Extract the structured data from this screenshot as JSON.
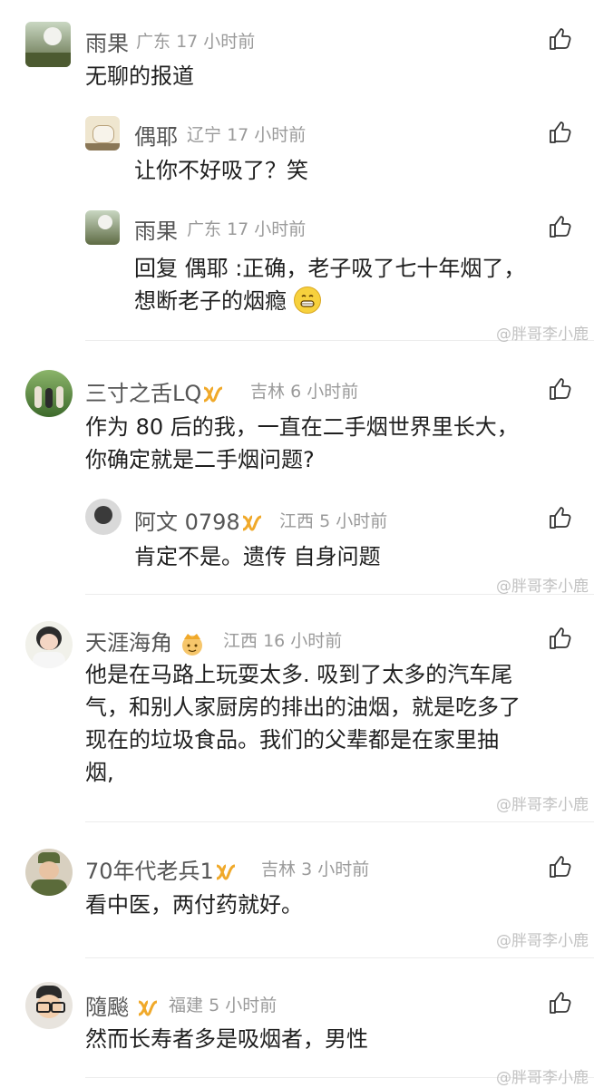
{
  "comments": [
    {
      "name": "雨果",
      "location": "广东",
      "time": "17 小时前",
      "text": "无聊的报道"
    },
    {
      "name": "偶耶",
      "location": "辽宁",
      "time": "17 小时前",
      "text": "让你不好吸了？笑"
    },
    {
      "name": "雨果",
      "location": "广东",
      "time": "17 小时前",
      "reply_prefix": "回复",
      "reply_target": "偶耶",
      "line1": ":正确，老子吸了七十年烟了，",
      "line2": "想断老子的烟瘾"
    },
    {
      "name": "三寸之舌LQ",
      "location": "吉林",
      "time": "6 小时前",
      "line1": "作为 80 后的我，一直在二手烟世界里长大，",
      "line2": "你确定就是二手烟问题?"
    },
    {
      "name": "阿文 0798",
      "location": "江西",
      "time": "5 小时前",
      "text": "肯定不是。遗传 自身问题"
    },
    {
      "name": "天涯海角",
      "location": "江西",
      "time": "16 小时前",
      "line1": "他是在马路上玩耍太多. 吸到了太多的汽车尾",
      "line2": "气，和别人家厨房的排出的油烟，就是吃多了",
      "line3": "现在的垃圾食品。我们的父辈都是在家里抽",
      "line4": "烟,"
    },
    {
      "name": "70年代老兵1",
      "location": "吉林",
      "time": "3 小时前",
      "text": "看中医，两付药就好。"
    },
    {
      "name": "隨飈",
      "location": "福建",
      "time": "5 小时前",
      "text": "然而长寿者多是吸烟者，男性"
    }
  ],
  "watermark": "@胖哥李小鹿",
  "colors": {
    "vip_badge": "#f0a92a",
    "name": "#555555",
    "meta": "#9a9a9a"
  }
}
